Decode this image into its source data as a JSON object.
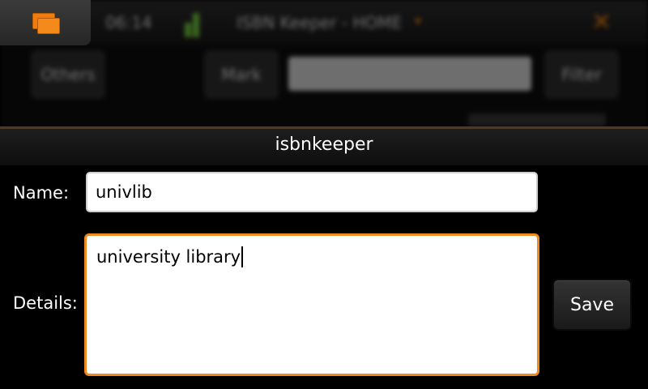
{
  "background_app": {
    "clock": "06:14",
    "title": "ISBN Keeper - HOME",
    "dropdown_icon": "chevron-down-icon",
    "close_icon": "close-icon",
    "buttons": {
      "others": "Others",
      "mark": "Mark",
      "filter": "Filter"
    }
  },
  "switcher": {
    "icon": "task-switcher-icon",
    "color": "#f07c10"
  },
  "dialog": {
    "title": "isbnkeeper",
    "name_label": "Name:",
    "name_value": "univlib",
    "details_label": "Details:",
    "details_value": "university library",
    "save_label": "Save",
    "focus_color": "#f08a1e"
  }
}
